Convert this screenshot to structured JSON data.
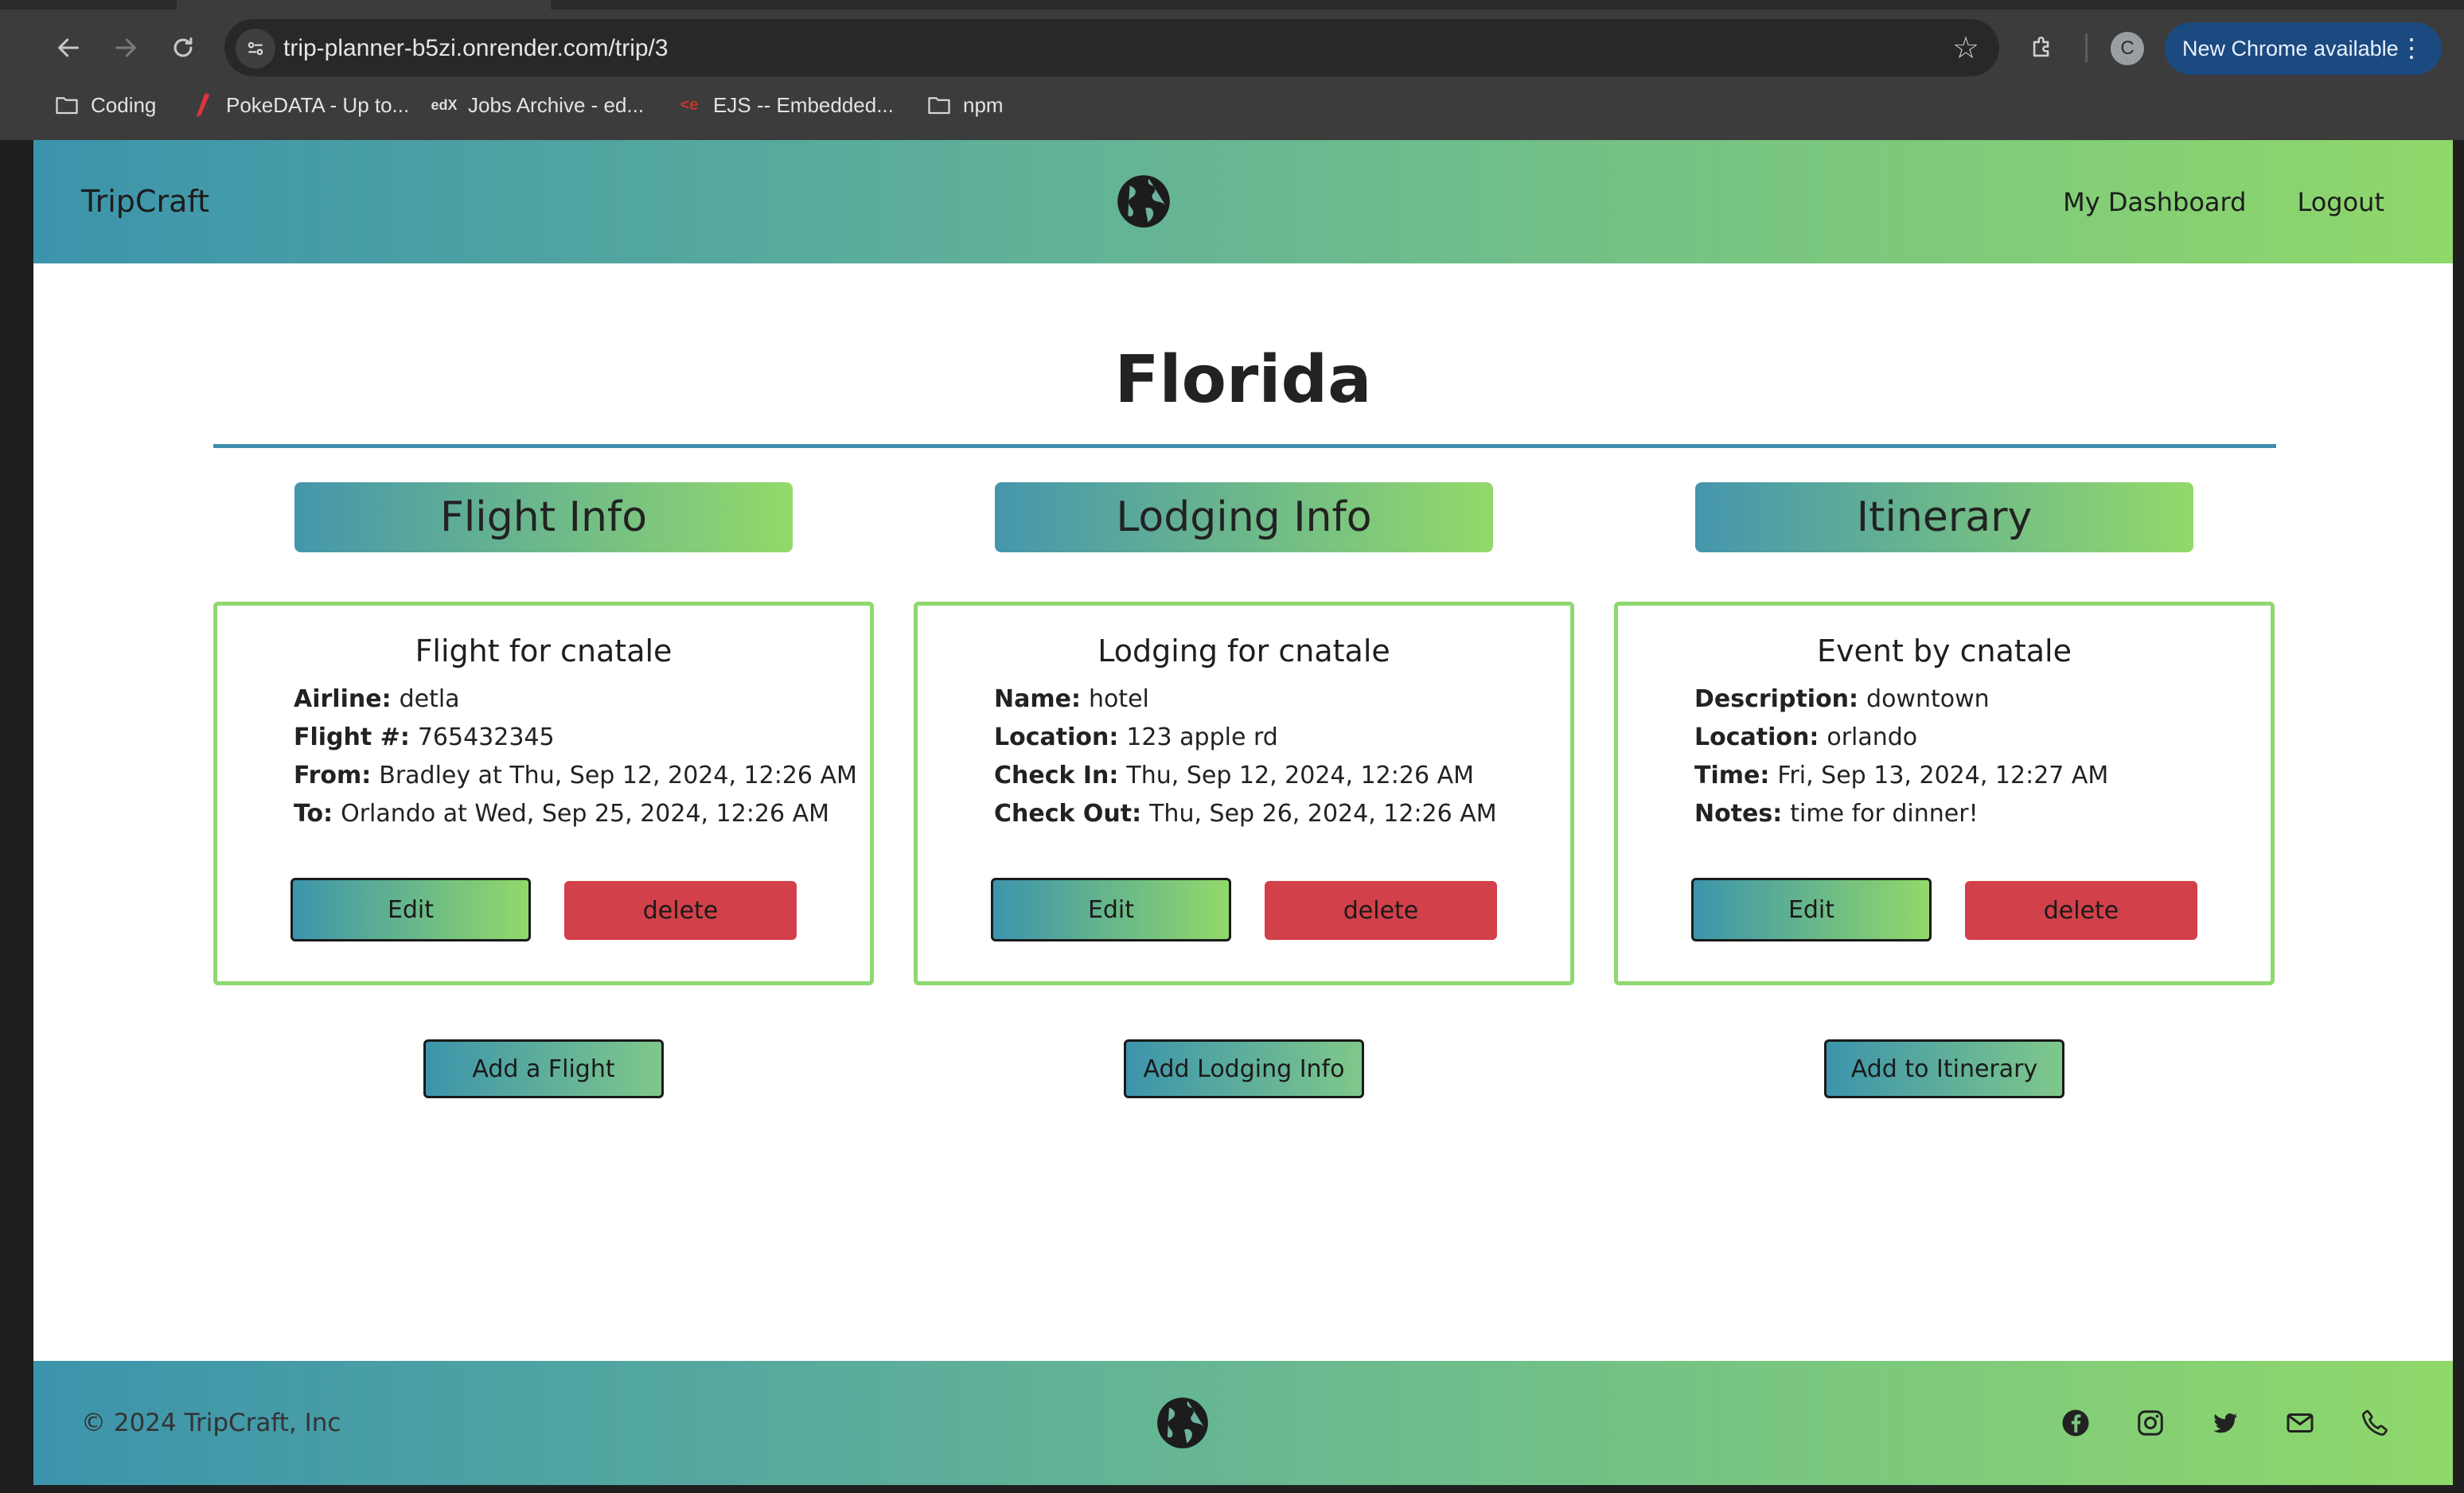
{
  "browser": {
    "url": "trip-planner-b5zi.onrender.com/trip/3",
    "profile_initial": "C",
    "update_label": "New Chrome available",
    "bookmarks": [
      {
        "label": "Coding",
        "icon": "folder-icon"
      },
      {
        "label": "PokeDATA - Up to...",
        "icon": "pokedata-favicon"
      },
      {
        "label": "Jobs Archive - ed...",
        "icon": "edx-favicon"
      },
      {
        "label": "EJS -- Embedded...",
        "icon": "ejs-favicon"
      },
      {
        "label": "npm",
        "icon": "folder-icon"
      }
    ]
  },
  "header": {
    "brand": "TripCraft",
    "logo_icon": "globe-icon",
    "nav": [
      "My Dashboard",
      "Logout"
    ]
  },
  "trip": {
    "title": "Florida"
  },
  "flight": {
    "heading": "Flight Info",
    "card_title": "Flight for cnatale",
    "fields": [
      {
        "label": "Airline:",
        "value": "detla"
      },
      {
        "label": "Flight #:",
        "value": "765432345"
      },
      {
        "label": "From:",
        "value": "Bradley at Thu, Sep 12, 2024, 12:26 AM"
      },
      {
        "label": "To:",
        "value": "Orlando at Wed, Sep 25, 2024, 12:26 AM"
      }
    ],
    "edit_label": "Edit",
    "delete_label": "delete",
    "add_label": "Add a Flight"
  },
  "lodging": {
    "heading": "Lodging Info",
    "card_title": "Lodging for cnatale",
    "fields": [
      {
        "label": "Name:",
        "value": "hotel"
      },
      {
        "label": "Location:",
        "value": "123 apple rd"
      },
      {
        "label": "Check In:",
        "value": "Thu, Sep 12, 2024, 12:26 AM"
      },
      {
        "label": "Check Out:",
        "value": "Thu, Sep 26, 2024, 12:26 AM"
      }
    ],
    "edit_label": "Edit",
    "delete_label": "delete",
    "add_label": "Add Lodging Info"
  },
  "itinerary": {
    "heading": "Itinerary",
    "card_title": "Event by cnatale",
    "fields": [
      {
        "label": "Description:",
        "value": "downtown"
      },
      {
        "label": "Location:",
        "value": "orlando"
      },
      {
        "label": "Time:",
        "value": "Fri, Sep 13, 2024, 12:27 AM"
      },
      {
        "label": "Notes:",
        "value": "time for dinner!"
      }
    ],
    "edit_label": "Edit",
    "delete_label": "delete",
    "add_label": "Add to Itinerary"
  },
  "footer": {
    "copyright": "© 2024 TripCraft, Inc",
    "logo_icon": "globe-icon",
    "social_icons": [
      "facebook-icon",
      "instagram-icon",
      "twitter-icon",
      "envelope-icon",
      "telephone-icon"
    ]
  },
  "colors": {
    "gradient_start": "#3c94ac",
    "gradient_end": "#8fd86a",
    "card_border": "#8fd86f",
    "delete_red": "#d2404a",
    "title_rule": "#3d8ead",
    "chrome_update": "#1b4a80"
  }
}
